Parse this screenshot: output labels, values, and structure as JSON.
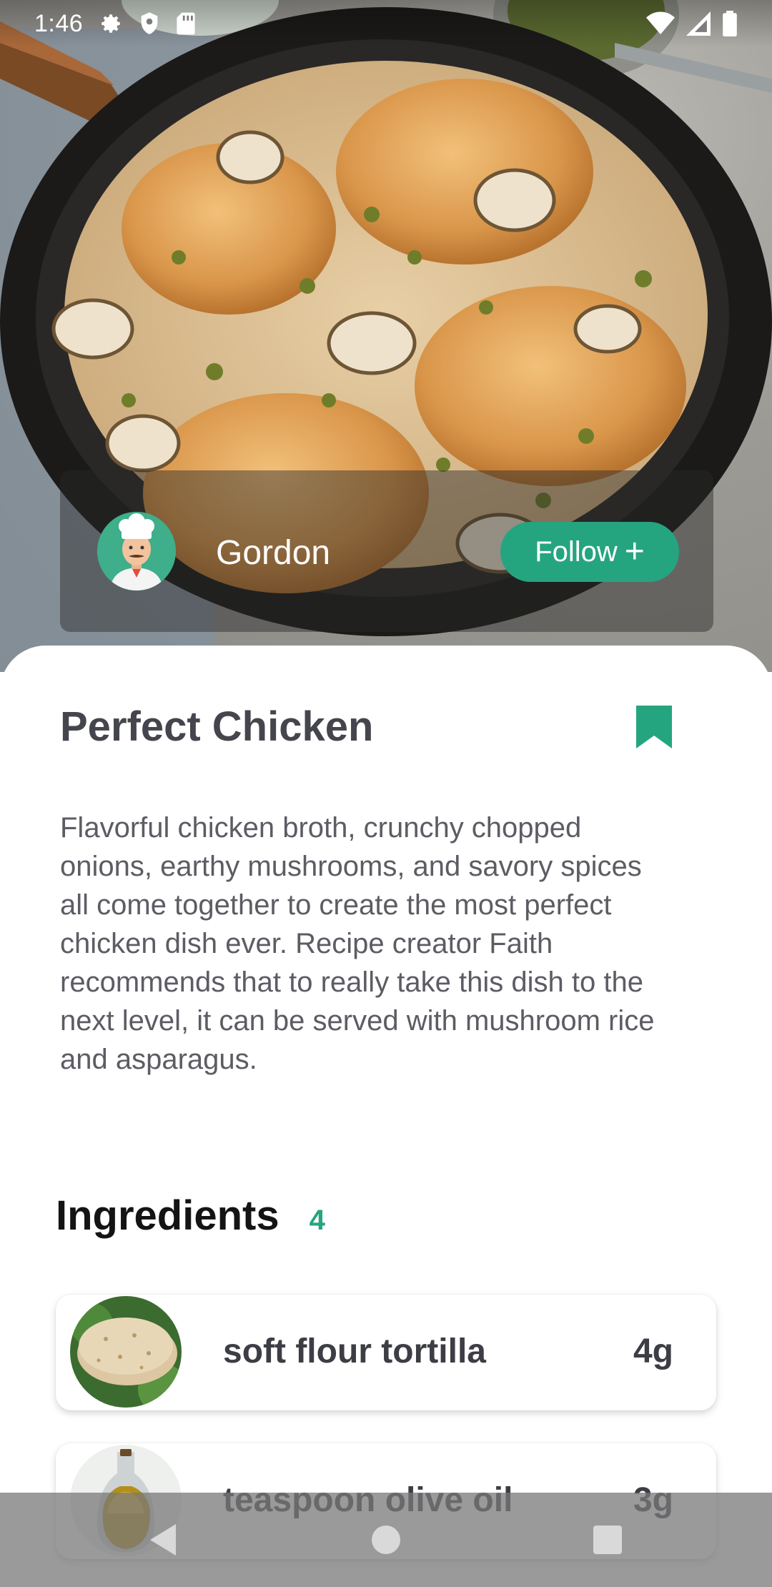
{
  "status_bar": {
    "time": "1:46",
    "icons": [
      "gear-icon",
      "shield-icon",
      "sd-card-icon",
      "wifi-icon",
      "signal-icon",
      "battery-icon"
    ]
  },
  "author": {
    "name": "Gordon",
    "follow_label": "Follow",
    "follow_icon": "plus-icon"
  },
  "recipe": {
    "title": "Perfect Chicken",
    "bookmark_icon": "bookmark-icon",
    "description": "Flavorful chicken broth, crunchy chopped onions, earthy mushrooms, and savory spices all come together to create the most perfect chicken dish ever. Recipe creator Faith recommends that to really take this dish to the next level, it can be served with mushroom rice and asparagus."
  },
  "ingredients": {
    "heading": "Ingredients",
    "count": "4",
    "items": [
      {
        "name": "soft flour tortilla",
        "quantity": "4g",
        "image": "tortilla-image"
      },
      {
        "name": "teaspoon olive oil",
        "quantity": "3g",
        "image": "olive-oil-image"
      }
    ]
  },
  "nav_bar": {
    "buttons": [
      "back-icon",
      "home-icon",
      "recents-icon"
    ]
  },
  "colors": {
    "accent": "#25a57f",
    "title_text": "#45454d",
    "body_text": "#5c5c64",
    "heading_text": "#141414"
  }
}
